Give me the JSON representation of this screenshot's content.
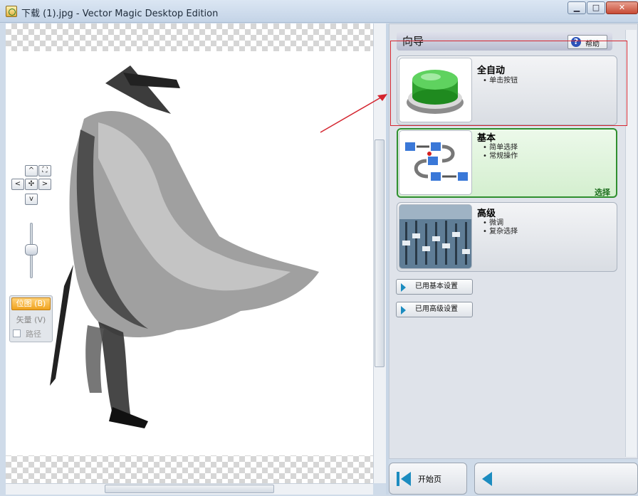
{
  "window": {
    "title": "下载 (1).jpg - Vector Magic Desktop Edition",
    "minimize_glyph": "▁",
    "maximize_glyph": "□",
    "close_glyph": "✕"
  },
  "nav": {
    "up": "^",
    "down": "v",
    "left": "<",
    "right": ">",
    "fit": "⛶",
    "center": "✣"
  },
  "view_mode": {
    "bitmap": "位图 (B)",
    "vector": "矢量 (V)",
    "path": "路径"
  },
  "wizard": {
    "title": "向导",
    "help_label": "帮助",
    "help_icon": "?",
    "modes": [
      {
        "title": "全自动",
        "bullets": [
          "单击按钮"
        ]
      },
      {
        "title": "基本",
        "bullets": [
          "简单选择",
          "常规操作"
        ],
        "status": "选择"
      },
      {
        "title": "高级",
        "bullets": [
          "微调",
          "复杂选择"
        ]
      }
    ],
    "settings_buttons": [
      "已用基本设置",
      "已用高级设置"
    ]
  },
  "footer": {
    "home_label": "开始页"
  },
  "colors": {
    "accent_green": "#2f8f2f",
    "bitmap_orange": "#f0a21e",
    "annotation_red": "#d4252f"
  },
  "icons": [
    "app-icon",
    "help-icon",
    "green-button-icon",
    "workflow-icon",
    "mixer-icon",
    "start-page-icon",
    "back-icon"
  ]
}
